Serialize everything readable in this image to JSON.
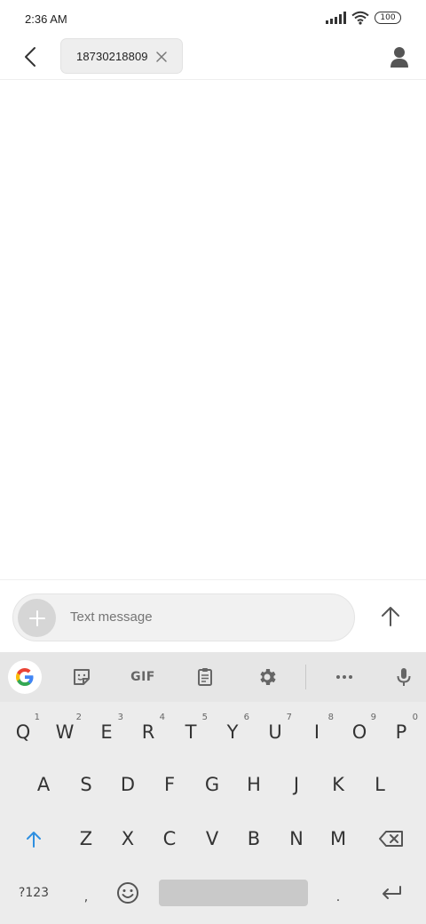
{
  "status_bar": {
    "time": "2:36 AM",
    "battery": "100"
  },
  "header": {
    "recipient": "18730218809"
  },
  "compose": {
    "placeholder": "Text message"
  },
  "keyboard": {
    "toolbar": {
      "gif_label": "GIF"
    },
    "row1": [
      {
        "letter": "Q",
        "hint": "1"
      },
      {
        "letter": "W",
        "hint": "2"
      },
      {
        "letter": "E",
        "hint": "3"
      },
      {
        "letter": "R",
        "hint": "4"
      },
      {
        "letter": "T",
        "hint": "5"
      },
      {
        "letter": "Y",
        "hint": "6"
      },
      {
        "letter": "U",
        "hint": "7"
      },
      {
        "letter": "I",
        "hint": "8"
      },
      {
        "letter": "O",
        "hint": "9"
      },
      {
        "letter": "P",
        "hint": "0"
      }
    ],
    "row2": [
      "A",
      "S",
      "D",
      "F",
      "G",
      "H",
      "J",
      "K",
      "L"
    ],
    "row3": [
      "Z",
      "X",
      "C",
      "V",
      "B",
      "N",
      "M"
    ],
    "symbols_label": "?123",
    "comma_label": ",",
    "period_label": "."
  }
}
